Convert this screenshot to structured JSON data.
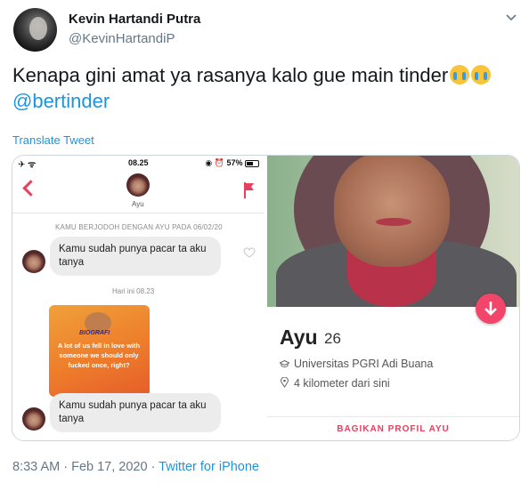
{
  "tweet": {
    "display_name": "Kevin Hartandi Putra",
    "handle": "@KevinHartandiP",
    "text": "Kenapa gini amat ya rasanya kalo gue main tinder",
    "mention": "@bertinder",
    "translate_label": "Translate Tweet",
    "timestamp": "8:33 AM · Feb 17, 2020 · ",
    "source": "Twitter for iPhone"
  },
  "chat": {
    "status_time": "08.25",
    "status_left": "✈ ᯤ",
    "status_right": "◉ ⏰ 57%",
    "contact_name": "Ayu",
    "matched_text": "KAMU BERJODOH DENGAN AYU PADA 06/02/20",
    "message_1": "Kamu sudah punya pacar ta aku tanya",
    "today_label": "Hari ini  08.23",
    "story_label": "BIOGRAFI",
    "story_quote": "A lot of us fell in love with someone we should only fucked once, right?",
    "message_2": "Kamu sudah punya pacar ta aku tanya"
  },
  "profile": {
    "name": "Ayu",
    "age": "26",
    "school": "Universitas PGRI Adi Buana",
    "distance": "4 kilometer dari sini",
    "share_label": "BAGIKAN PROFIL AYU"
  },
  "colors": {
    "link": "#1b95e0",
    "tinder_red": "#e5405e"
  }
}
